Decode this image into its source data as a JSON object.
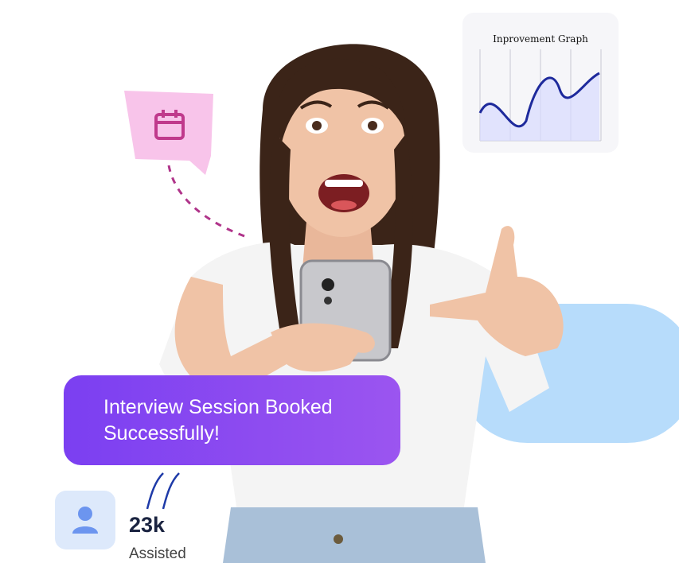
{
  "graph": {
    "title": "Inprovement Graph",
    "line_color": "#1e2a9c",
    "fill_color": "#d9dcff"
  },
  "toast": {
    "line1": "Interview Session Booked",
    "line2": "Successfully!",
    "background": "#8a4af0"
  },
  "stat": {
    "value": "23k",
    "label": "Assisted",
    "icon": "user-icon"
  },
  "chat_bubble": {
    "icon": "calendar-icon",
    "color": "#f8c4ea"
  }
}
